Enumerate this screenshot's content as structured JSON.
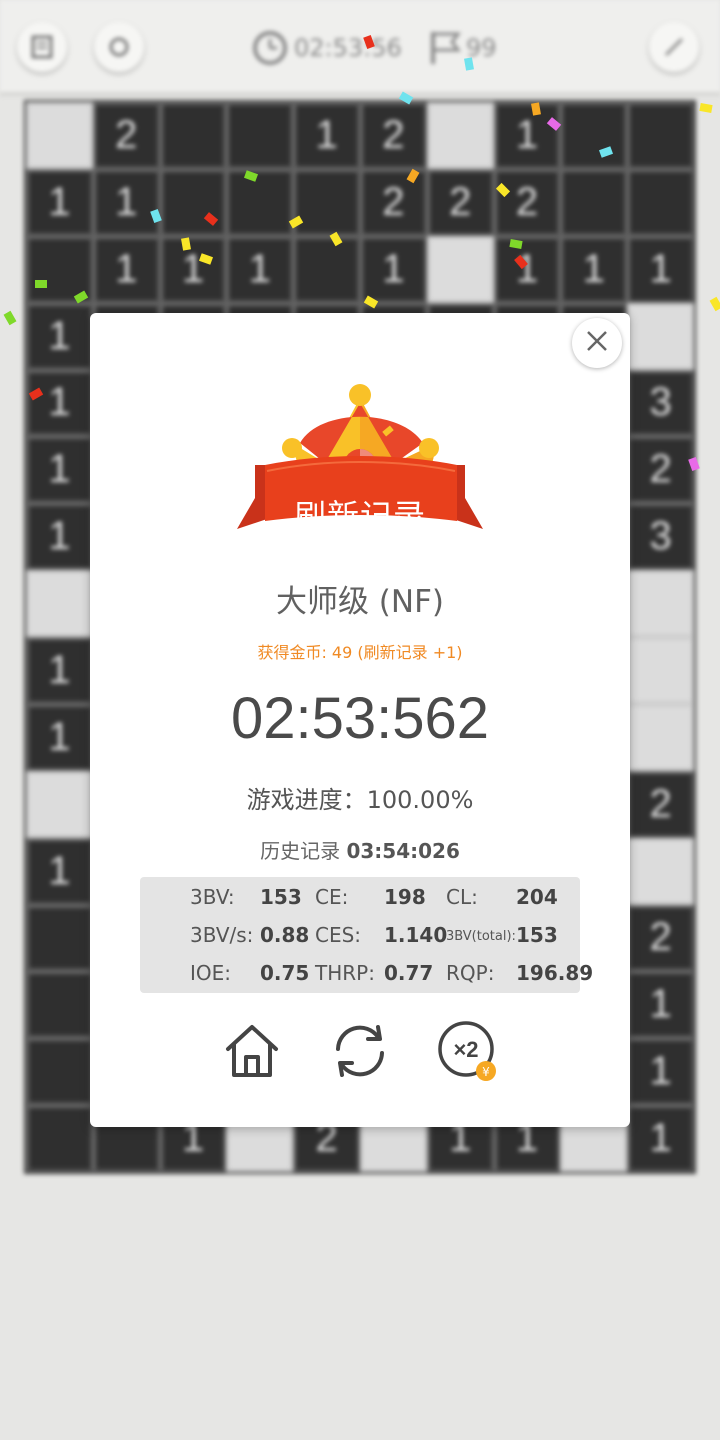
{
  "topbar": {
    "timer": "02:53:56",
    "mines": "99",
    "icons": [
      "menu-icon",
      "restart-icon",
      "clock-icon",
      "flag-icon",
      "settings-icon"
    ]
  },
  "board": {
    "rows": [
      [
        "",
        "2",
        "",
        "",
        "1",
        "2",
        "",
        "1",
        "",
        ""
      ],
      [
        "1",
        "1",
        "",
        "",
        "",
        "2",
        "2",
        "2",
        "",
        ""
      ],
      [
        "",
        "1",
        "1",
        "1",
        "",
        "1",
        "",
        "1",
        "1",
        "1"
      ],
      [
        "1",
        "",
        "",
        "",
        "",
        "",
        "",
        "",
        "",
        ""
      ],
      [
        "1",
        "",
        "",
        "",
        "",
        "",
        "",
        "",
        "",
        "3"
      ],
      [
        "1",
        "",
        "",
        "",
        "",
        "",
        "",
        "",
        "",
        "2"
      ],
      [
        "1",
        "",
        "",
        "",
        "",
        "",
        "",
        "",
        "",
        "3"
      ],
      [
        "",
        "",
        "",
        "",
        "",
        "",
        "",
        "",
        "",
        ""
      ],
      [
        "1",
        "",
        "",
        "",
        "",
        "",
        "",
        "",
        "",
        ""
      ],
      [
        "1",
        "",
        "",
        "",
        "",
        "",
        "",
        "",
        "",
        ""
      ],
      [
        "",
        "",
        "",
        "",
        "",
        "",
        "",
        "",
        "",
        "2"
      ],
      [
        "1",
        "",
        "",
        "",
        "",
        "",
        "",
        "",
        "",
        ""
      ],
      [
        "",
        "",
        "",
        "",
        "",
        "",
        "",
        "",
        "",
        "2"
      ],
      [
        "",
        "",
        "",
        "",
        "",
        "",
        "",
        "",
        "",
        "1"
      ],
      [
        "",
        "",
        "",
        "",
        "",
        "",
        "",
        "",
        "",
        "1"
      ],
      [
        "",
        "",
        "1",
        "",
        "2",
        "",
        "1",
        "1",
        "",
        "1"
      ]
    ],
    "open": [
      [
        0,
        0
      ],
      [
        0,
        6
      ],
      [
        2,
        6
      ],
      [
        3,
        9
      ],
      [
        7,
        0
      ],
      [
        7,
        9
      ],
      [
        8,
        9
      ],
      [
        9,
        9
      ],
      [
        10,
        0
      ],
      [
        11,
        9
      ],
      [
        15,
        3
      ],
      [
        15,
        5
      ],
      [
        15,
        8
      ]
    ]
  },
  "dialog": {
    "badge": "刷新记录",
    "level": "大师级 (NF)",
    "coins": "获得金币: 49 (刷新记录 +1)",
    "time": "02:53:562",
    "progress_label": "游戏进度：",
    "progress_value": "100.00%",
    "history_label": "历史记录",
    "history_value": "03:54:026",
    "stats": {
      "bv_label": "3BV:",
      "bv_value": "153",
      "ce_label": "CE:",
      "ce_value": "198",
      "cl_label": "CL:",
      "cl_value": "204",
      "bvs_label": "3BV/s:",
      "bvs_value": "0.88",
      "ces_label": "CES:",
      "ces_value": "1.140",
      "bvt_label": "3BV(total):",
      "bvt_value": "153",
      "ioe_label": "IOE:",
      "ioe_value": "0.75",
      "thrp_label": "THRP:",
      "thrp_value": "0.77",
      "rqp_label": "RQP:",
      "rqp_value": "196.89"
    },
    "actions": [
      "home-icon",
      "replay-icon",
      "double-coins-icon"
    ],
    "double_label": "×2",
    "coin_symbol": "¥"
  },
  "colors": {
    "accent_orange": "#f08a24",
    "ribbon_red": "#e8401c",
    "crown_yellow": "#f9c128",
    "dialog_bg": "#ffffff"
  }
}
